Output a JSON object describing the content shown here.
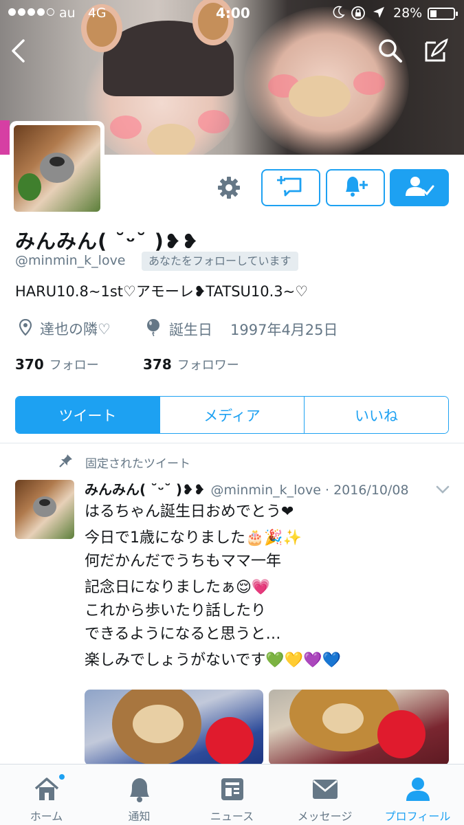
{
  "status_bar": {
    "carrier": "au",
    "network": "4G",
    "time": "4:00",
    "battery": "28%",
    "signal_bars": 4,
    "battery_level": 0.28
  },
  "header": {
    "back_icon": "back-arrow-icon",
    "search_icon": "search-icon",
    "compose_icon": "compose-icon"
  },
  "profile": {
    "name": "みんみん( ˘ᵕ˘ )❥❥",
    "handle": "@minmin_k_love",
    "follows_you": "あなたをフォローしています",
    "bio": "HARU10.8~1st♡アモーレ❥TATSU10.3~♡",
    "location": "達也の隣♡",
    "birthday_label": "誕生日",
    "birthday": "1997年4月25日",
    "following_count": "370",
    "following_label": "フォロー",
    "followers_count": "378",
    "followers_label": "フォロワー"
  },
  "tabs": [
    {
      "label": "ツイート",
      "active": true
    },
    {
      "label": "メディア",
      "active": false
    },
    {
      "label": "いいね",
      "active": false
    }
  ],
  "pinned_tweet": {
    "pinned_label": "固定されたツイート",
    "author_name": "みんみん( ˘ᵕ˘ )❥❥",
    "author_handle": "@minmin_k_love",
    "date": "· 2016/10/08",
    "lines": [
      "はるちゃん誕生日おめでとう❤",
      "今日で1歳になりました🎂🎉✨",
      "何だかんだでうちもママ一年",
      "記念日になりましたぁ😌💗",
      "これから歩いたり話したり",
      "できるようになると思うと…",
      "楽しみでしょうがないです💚💛💜💙"
    ]
  },
  "tab_bar": [
    {
      "label": "ホーム",
      "icon": "home-icon",
      "active": false,
      "badge": true
    },
    {
      "label": "通知",
      "icon": "bell-icon",
      "active": false,
      "badge": false
    },
    {
      "label": "ニュース",
      "icon": "news-icon",
      "active": false,
      "badge": false
    },
    {
      "label": "メッセージ",
      "icon": "envelope-icon",
      "active": false,
      "badge": false
    },
    {
      "label": "プロフィール",
      "icon": "person-icon",
      "active": true,
      "badge": false
    }
  ],
  "colors": {
    "accent": "#1da1f2",
    "secondary_text": "#657786",
    "primary_text": "#14171a"
  }
}
